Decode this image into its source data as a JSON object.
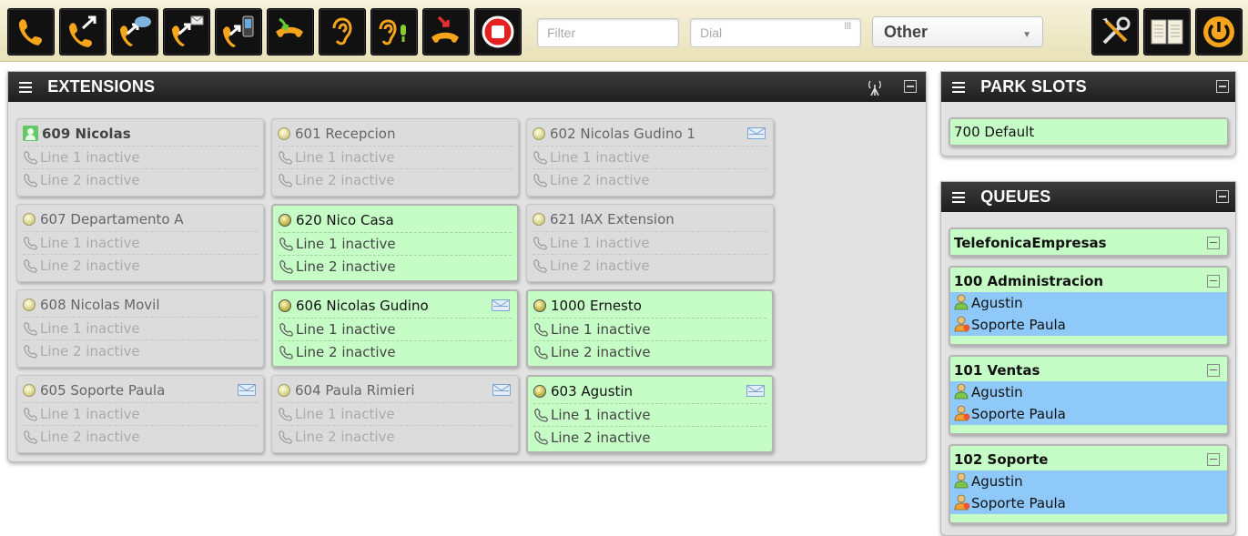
{
  "toolbar": {
    "buttons": [
      {
        "name": "dial-icon"
      },
      {
        "name": "transfer-icon"
      },
      {
        "name": "chat-icon"
      },
      {
        "name": "voicemail-icon"
      },
      {
        "name": "mobile-icon"
      },
      {
        "name": "pickup-icon"
      },
      {
        "name": "listen-icon"
      },
      {
        "name": "whisper-icon"
      },
      {
        "name": "hangup-icon"
      },
      {
        "name": "record-icon"
      }
    ],
    "filter_placeholder": "Filter",
    "dial_placeholder": "Dial",
    "group_select": "Other",
    "right_buttons": [
      {
        "name": "tools-icon"
      },
      {
        "name": "phonebook-icon"
      },
      {
        "name": "power-icon"
      }
    ]
  },
  "extensions_panel": {
    "title": "EXTENSIONS",
    "cards": [
      {
        "label": "609 Nicolas",
        "line1": "Line 1 inactive",
        "line2": "Line 2 inactive",
        "active": false,
        "self": true,
        "mail": false
      },
      {
        "label": "601 Recepcion",
        "line1": "Line 1 inactive",
        "line2": "Line 2 inactive",
        "active": false,
        "self": false,
        "mail": false
      },
      {
        "label": "602 Nicolas Gudino 1",
        "line1": "Line 1 inactive",
        "line2": "Line 2 inactive",
        "active": false,
        "self": false,
        "mail": true
      },
      {
        "label": "607 Departamento A",
        "line1": "Line 1 inactive",
        "line2": "Line 2 inactive",
        "active": false,
        "self": false,
        "mail": false
      },
      {
        "label": "620 Nico Casa",
        "line1": "Line 1 inactive",
        "line2": "Line 2 inactive",
        "active": true,
        "self": false,
        "mail": false
      },
      {
        "label": "621 IAX Extension",
        "line1": "Line 1 inactive",
        "line2": "Line 2 inactive",
        "active": false,
        "self": false,
        "mail": false
      },
      {
        "label": "608 Nicolas Movil",
        "line1": "Line 1 inactive",
        "line2": "Line 2 inactive",
        "active": false,
        "self": false,
        "mail": false
      },
      {
        "label": "606 Nicolas Gudino",
        "line1": "Line 1 inactive",
        "line2": "Line 2 inactive",
        "active": true,
        "self": false,
        "mail": true
      },
      {
        "label": "1000 Ernesto",
        "line1": "Line 1 inactive",
        "line2": "Line 2 inactive",
        "active": true,
        "self": false,
        "mail": false
      },
      {
        "label": "605 Soporte Paula",
        "line1": "Line 1 inactive",
        "line2": "Line 2 inactive",
        "active": false,
        "self": false,
        "mail": true
      },
      {
        "label": "604 Paula Rimieri",
        "line1": "Line 1 inactive",
        "line2": "Line 2 inactive",
        "active": false,
        "self": false,
        "mail": true
      },
      {
        "label": "603 Agustin",
        "line1": "Line 1 inactive",
        "line2": "Line 2 inactive",
        "active": true,
        "self": false,
        "mail": true
      }
    ]
  },
  "park_panel": {
    "title": "PARK SLOTS",
    "slots": [
      "700 Default"
    ]
  },
  "queues_panel": {
    "title": "QUEUES",
    "queues": [
      {
        "name": "TelefonicaEmpresas",
        "members": []
      },
      {
        "name": "100 Administracion",
        "members": [
          "Agustin",
          "Soporte Paula"
        ]
      },
      {
        "name": "101 Ventas",
        "members": [
          "Agustin",
          "Soporte Paula"
        ]
      },
      {
        "name": "102 Soporte",
        "members": [
          "Agustin",
          "Soporte Paula"
        ]
      }
    ]
  },
  "colors": {
    "active_card": "#c6fcc6",
    "member_row": "#8ec9fa",
    "panel_header": "#2a2a2a",
    "toolbar_bg": "#efe9c8"
  }
}
